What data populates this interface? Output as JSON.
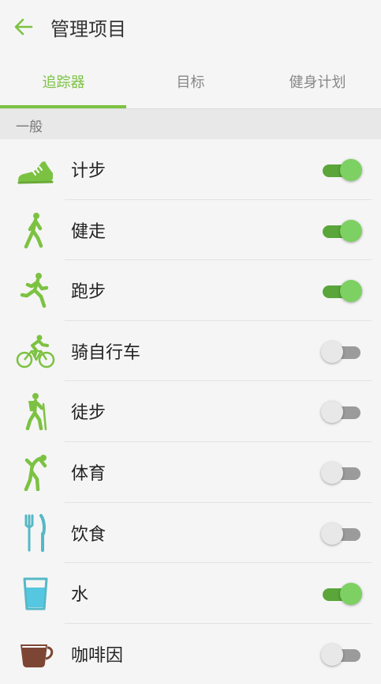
{
  "header": {
    "title": "管理项目",
    "back_icon": "arrow-left-icon"
  },
  "tabs": [
    {
      "label": "追踪器",
      "active": true
    },
    {
      "label": "目标",
      "active": false
    },
    {
      "label": "健身计划",
      "active": false
    }
  ],
  "section": {
    "label": "一般"
  },
  "colors": {
    "accent": "#7cc242",
    "toggle_on_track": "#5aa63a",
    "toggle_on_knob": "#7dd162",
    "toggle_off_track": "#9b9b9b"
  },
  "items": [
    {
      "label": "计步",
      "icon": "shoe-icon",
      "enabled": true
    },
    {
      "label": "健走",
      "icon": "walking-icon",
      "enabled": true
    },
    {
      "label": "跑步",
      "icon": "running-icon",
      "enabled": true
    },
    {
      "label": "骑自行车",
      "icon": "cycling-icon",
      "enabled": false
    },
    {
      "label": "徒步",
      "icon": "hiking-icon",
      "enabled": false
    },
    {
      "label": "体育",
      "icon": "sports-icon",
      "enabled": false
    },
    {
      "label": "饮食",
      "icon": "fork-knife-icon",
      "enabled": false
    },
    {
      "label": "水",
      "icon": "water-glass-icon",
      "enabled": true
    },
    {
      "label": "咖啡因",
      "icon": "coffee-cup-icon",
      "enabled": false
    }
  ]
}
